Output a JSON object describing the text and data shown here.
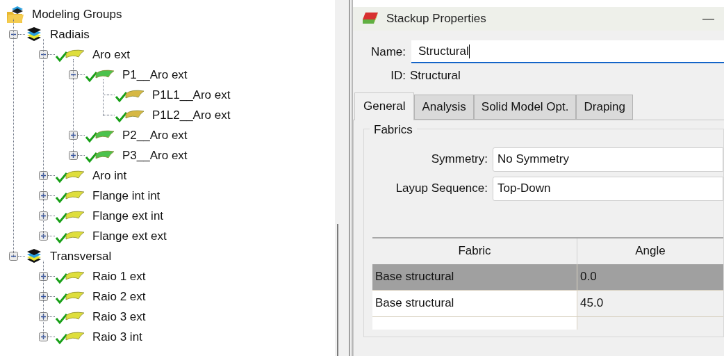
{
  "tree": {
    "label": "Modeling Groups",
    "kind": "folder",
    "children": [
      {
        "label": "Radiais",
        "kind": "group",
        "expanded": true,
        "children": [
          {
            "label": "Aro ext",
            "kind": "ply",
            "color": "#dede3c",
            "checked": true,
            "expanded": true,
            "children": [
              {
                "label": "P1__Aro ext",
                "kind": "ply",
                "color": "#4cc24c",
                "checked": true,
                "expanded": true,
                "children": [
                  {
                    "label": "P1L1__Aro ext",
                    "kind": "ply",
                    "color": "#d6b844",
                    "checked": true
                  },
                  {
                    "label": "P1L2__Aro ext",
                    "kind": "ply",
                    "color": "#d6b844",
                    "checked": true
                  }
                ]
              },
              {
                "label": "P2__Aro ext",
                "kind": "ply",
                "color": "#4cc24c",
                "checked": true,
                "expanded": false
              },
              {
                "label": "P3__Aro ext",
                "kind": "ply",
                "color": "#4cc24c",
                "checked": true,
                "expanded": false
              }
            ]
          },
          {
            "label": "Aro int",
            "kind": "ply",
            "color": "#dede3c",
            "checked": true,
            "expanded": false
          },
          {
            "label": "Flange int int",
            "kind": "ply",
            "color": "#dede3c",
            "checked": true,
            "expanded": false
          },
          {
            "label": "Flange ext int",
            "kind": "ply",
            "color": "#dede3c",
            "checked": true,
            "expanded": false
          },
          {
            "label": "Flange ext ext",
            "kind": "ply",
            "color": "#dede3c",
            "checked": true,
            "expanded": false
          }
        ]
      },
      {
        "label": "Transversal",
        "kind": "group",
        "expanded": true,
        "children": [
          {
            "label": "Raio 1 ext",
            "kind": "ply",
            "color": "#dede3c",
            "checked": true,
            "expanded": false
          },
          {
            "label": "Raio 2 ext",
            "kind": "ply",
            "color": "#dede3c",
            "checked": true,
            "expanded": false
          },
          {
            "label": "Raio 3 ext",
            "kind": "ply",
            "color": "#dede3c",
            "checked": true,
            "expanded": false
          },
          {
            "label": "Raio 3 int",
            "kind": "ply",
            "color": "#dede3c",
            "checked": true,
            "expanded": false
          }
        ]
      }
    ]
  },
  "dialog": {
    "title": "Stackup Properties",
    "minimize": "—",
    "name_label": "Name:",
    "name_value": "Structural",
    "id_label": "ID:",
    "id_value": "Structural",
    "tabs": [
      {
        "label": "General",
        "selected": true
      },
      {
        "label": "Analysis",
        "selected": false
      },
      {
        "label": "Solid Model Opt.",
        "selected": false
      },
      {
        "label": "Draping",
        "selected": false
      }
    ],
    "group_title": "Fabrics",
    "fields": [
      {
        "label": "Symmetry:",
        "value": "No Symmetry"
      },
      {
        "label": "Layup Sequence:",
        "value": "Top-Down"
      }
    ],
    "table": {
      "columns": [
        "Fabric",
        "Angle"
      ],
      "rows": [
        {
          "cells": [
            "Base structural",
            "0.0"
          ],
          "selected": true
        },
        {
          "cells": [
            "Base structural",
            "45.0"
          ],
          "selected": false
        }
      ]
    }
  }
}
